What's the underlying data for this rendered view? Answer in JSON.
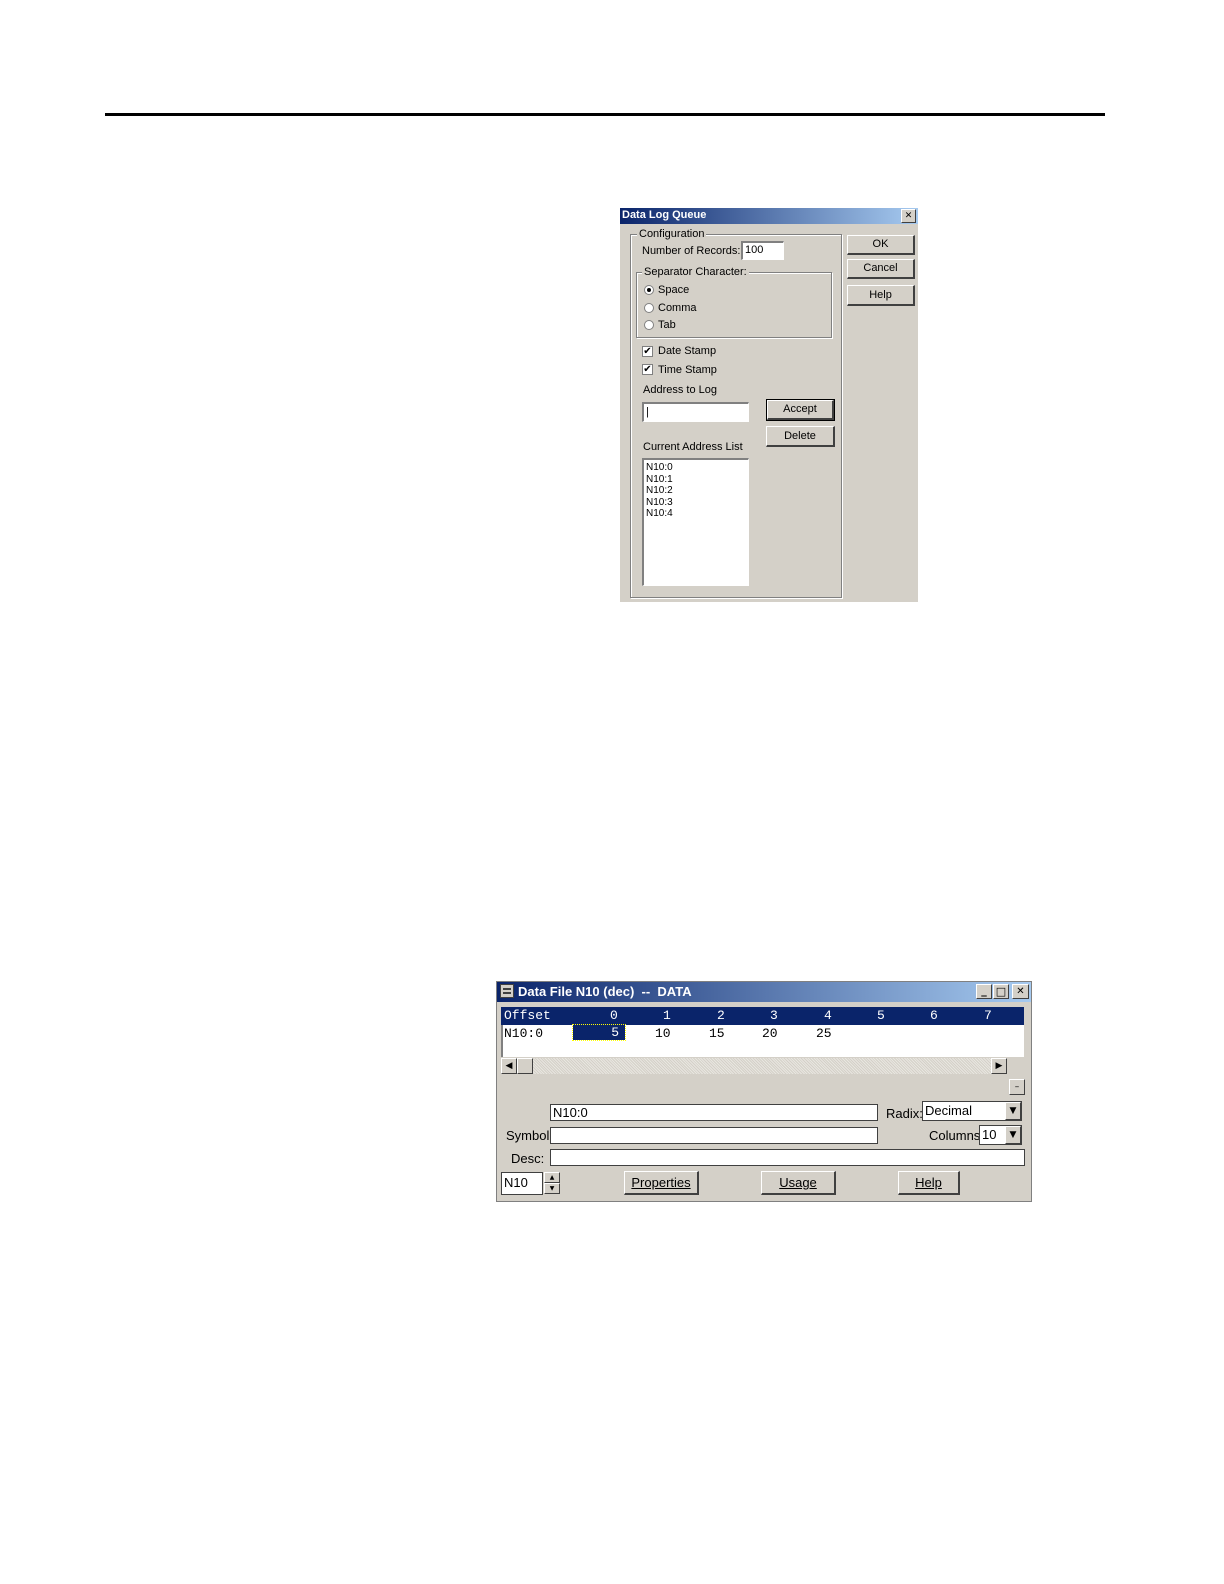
{
  "dialog": {
    "title": "Data Log Queue",
    "close_glyph": "✕",
    "configuration_label": "Configuration",
    "num_records_label": "Number of Records:",
    "num_records_value": "100",
    "separator_label": "Separator Character:",
    "separators": [
      {
        "label": "Space",
        "selected": true
      },
      {
        "label": "Comma",
        "selected": false
      },
      {
        "label": "Tab",
        "selected": false
      }
    ],
    "date_stamp_label": "Date Stamp",
    "date_stamp_checked": true,
    "time_stamp_label": "Time Stamp",
    "time_stamp_checked": true,
    "check_glyph": "✔",
    "address_label": "Address to Log",
    "address_value": "|",
    "accept_label": "Accept",
    "delete_label": "Delete",
    "current_list_label": "Current Address List",
    "addresses": [
      "N10:0",
      "N10:1",
      "N10:2",
      "N10:3",
      "N10:4"
    ],
    "ok_label": "OK",
    "cancel_label": "Cancel",
    "help_label": "Help"
  },
  "datafile": {
    "title": "Data File N10 (dec)  --  DATA",
    "minimize_glyph": "_",
    "maximize_glyph": "□",
    "close_glyph": "✕",
    "offset_header": "Offset",
    "columns": [
      "0",
      "1",
      "2",
      "3",
      "4",
      "5",
      "6",
      "7"
    ],
    "row_label": "N10:0",
    "row_values": [
      "5",
      "10",
      "15",
      "20",
      "25"
    ],
    "address_value": "N10:0",
    "radix_label": "Radix:",
    "radix_value": "Decimal",
    "symbol_label": "Symbol:",
    "symbol_value": "",
    "columns_label": "Columns:",
    "columns_value": "10",
    "desc_label": "Desc:",
    "desc_value": "",
    "file_value": "N10",
    "properties_label": "Properties",
    "usage_label": "Usage",
    "help_label": "Help",
    "arrow_left": "◀",
    "arrow_right": "▶",
    "arrow_down": "▼",
    "arrow_up_small": "▲",
    "dash": "–"
  }
}
